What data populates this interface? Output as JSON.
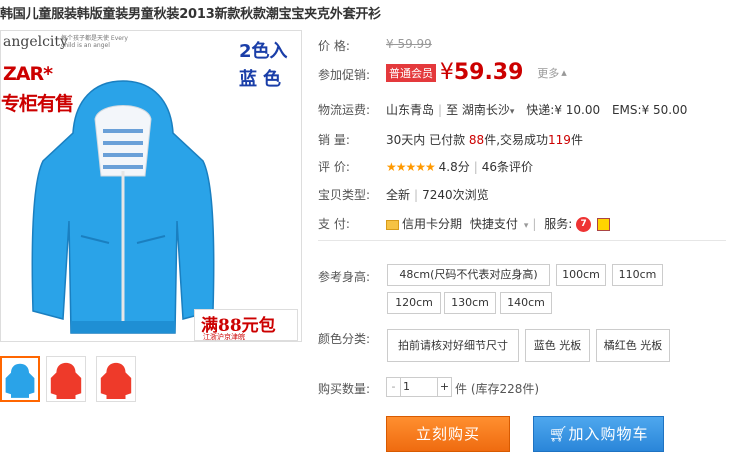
{
  "title": "韩国儿童服装韩版童装男童秋装2013新款秋款潮宝宝夹克外套开衫",
  "gallery": {
    "brand": "angelcity",
    "brand_sub": "每个孩子都是天使 Every child is an angel",
    "badge_zar": "ZAR*",
    "badge_counter": "专柜有售",
    "color_count": "2色入",
    "color_name": "蓝色",
    "promo_main": "满88元包",
    "promo_sub": "江浙沪京津皖",
    "zoom_icon": "magnifier-icon",
    "thumbnails": [
      "blue",
      "red",
      "red"
    ]
  },
  "price": {
    "label": "价    格:",
    "original": "¥ 59.99",
    "promo_label": "参加促销:",
    "vip_tag": "普通会员",
    "currency": "¥",
    "value": "59.39",
    "more": "更多"
  },
  "shipping": {
    "label": "物流运费:",
    "from": "山东青岛",
    "to_prefix": "至",
    "to": "湖南长沙",
    "express": "快递:¥ 10.00",
    "ems": "EMS:¥ 50.00"
  },
  "sales": {
    "label": "销    量:",
    "prefix": "30天内 已付款",
    "paid": "88",
    "middle": "件,交易成功",
    "done": "119",
    "suffix": "件"
  },
  "rating": {
    "label": "评    价:",
    "stars": "★★★★★",
    "score": "4.8分",
    "reviews": "46条评价"
  },
  "item_type": {
    "label": "宝贝类型:",
    "value": "全新",
    "views": "7240次浏览"
  },
  "payment": {
    "label": "支    付:",
    "credit": "信用卡分期",
    "quick": "快捷支付",
    "service_label": "服务:"
  },
  "sizes": {
    "label": "参考身高:",
    "options": [
      "48cm(尺码不代表对应身高)",
      "100cm",
      "110cm",
      "120cm",
      "130cm",
      "140cm"
    ]
  },
  "colors": {
    "label": "颜色分类:",
    "options": [
      "拍前请核对好细节尺寸",
      "蓝色 光板",
      "橘红色 光板"
    ]
  },
  "quantity": {
    "label": "购买数量:",
    "value": "1",
    "stock": "件 (库存228件)"
  },
  "actions": {
    "buy": "立刻购买",
    "cart": "加入购物车"
  },
  "colors_theme": {
    "price_red": "#cc0000",
    "buy_orange": "#f57a20",
    "cart_blue": "#2a86d9",
    "jacket_blue": "#29a3e8"
  }
}
